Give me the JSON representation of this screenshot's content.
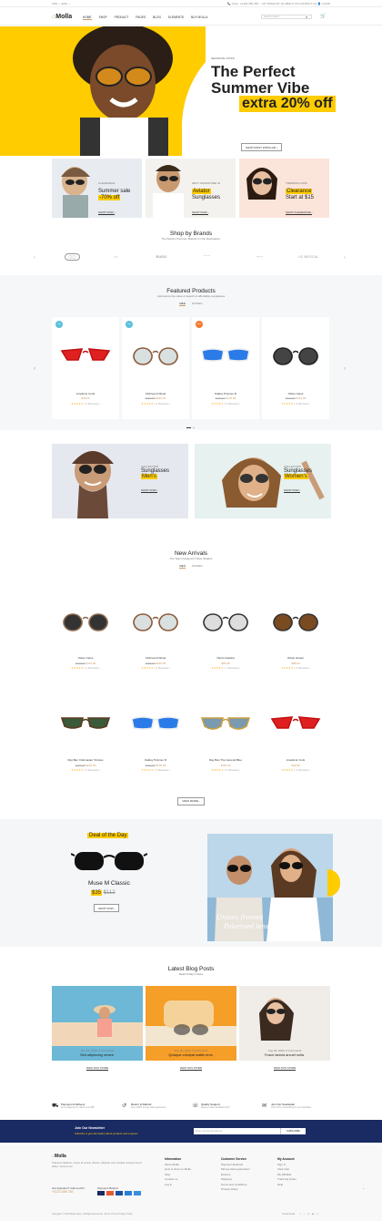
{
  "topbar": {
    "left": "USD ⌄   ENG ⌄",
    "right": "📞 CALL: +0123 456 789   ♡ MY WISHLIST (3)   ABOUT US   CONTACT US   👤 LOGIN"
  },
  "header": {
    "logo": "Molla",
    "nav": [
      "HOME",
      "SHOP",
      "PRODUCT",
      "PAGES",
      "BLOG",
      "ELEMENTS",
      "BUY MOLLA"
    ],
    "search_placeholder": "Search product ..."
  },
  "hero": {
    "kicker": "SEASONAL PICKS",
    "title1": "The Perfect",
    "title2": "Summer Vibe",
    "title3": "extra 20% off",
    "cta": "SHOP MOST POPULAR ›"
  },
  "banners": [
    {
      "kicker": "CLEARANCE",
      "line1": "Summer sale",
      "line2": "-70% off",
      "cta": "SHOP NOW ›"
    },
    {
      "kicker": "NEXT ADVENTURE IN",
      "line1": "Aviator",
      "line2": "Sunglasses",
      "cta": "SHOP NOW ›"
    },
    {
      "kicker": "TRENDING NOW",
      "line1": "Clearance",
      "line2": "Start at $15",
      "cta": "SHOP CLEARANCE ›"
    }
  ],
  "brands": {
    "title": "Shop by Brands",
    "subtitle": "The World's Premium Brands In One Destination.",
    "logos": [
      "",
      "",
      "RUGO",
      "",
      "",
      "LE BROCAL"
    ]
  },
  "featured": {
    "title": "Featured Products",
    "subtitle": "Aprimentre the video of search of affordable sunglasses",
    "tabs": [
      "MEN",
      "WOMEN"
    ],
    "products": [
      {
        "badge": "Top",
        "name": "Amelia E. Funk",
        "price": "$49.99",
        "old": "",
        "reviews": "( 4 Reviews )"
      },
      {
        "badge": "Top",
        "name": "Clubround Wood",
        "price": "$224.00",
        "old": "$250.00",
        "reviews": "( 2 Reviews )"
      },
      {
        "badge": "New",
        "name": "Oakley Polymer R",
        "price": "$178.00",
        "old": "$190.00",
        "reviews": "( 5 Reviews )"
      },
      {
        "badge": "",
        "name": "Ottoto Caine",
        "price": "$114.00",
        "old": "$140.00",
        "reviews": "( 4 Reviews )"
      }
    ]
  },
  "collections": [
    {
      "kicker": "COLLECTION",
      "line1": "Sunglasses",
      "line2": "Men's",
      "cta": "SHOP NOW ›"
    },
    {
      "kicker": "COLLECTION",
      "line1": "Sunglasses",
      "line2": "Women's",
      "cta": "SHOP NOW ›"
    }
  ],
  "arrivals": {
    "title": "New Arrivals",
    "subtitle": "Our Team Designed These Shades",
    "tabs": [
      "MEN",
      "WOMEN"
    ],
    "products": [
      {
        "badge": "",
        "name": "Ottoto Caine",
        "price": "$114.00",
        "old": "$130.00",
        "reviews": "( 4 Reviews )"
      },
      {
        "badge": "",
        "name": "Clubround Wood",
        "price": "$224.00",
        "old": "$280.00",
        "reviews": "( 2 Reviews )"
      },
      {
        "badge": "",
        "name": "Ottoto Caledra",
        "price": "$84.00",
        "old": "",
        "reviews": "( 1 Reviews )"
      },
      {
        "badge": "",
        "name": "Ottoto Harper",
        "price": "$88.00",
        "old": "",
        "reviews": "( 3 Reviews )"
      },
      {
        "badge": "",
        "name": "Ray Ban Clubmaster Tortoise",
        "price": "$210.00",
        "old": "$230.00",
        "reviews": "( 4 Reviews )"
      },
      {
        "badge": "",
        "name": "Oakley Polymer R",
        "price": "$178.00",
        "old": "$190.00",
        "reviews": "( 4 Reviews )"
      },
      {
        "badge": "",
        "name": "Ray Ban The General Blue",
        "price": "$160.00",
        "old": "",
        "reviews": "( 5 Reviews )"
      },
      {
        "badge": "",
        "name": "Amelia E. Funk",
        "price": "$49.99",
        "old": "",
        "reviews": "( 4 Reviews )"
      }
    ],
    "more": "VIEW MORE ›"
  },
  "deal": {
    "label": "Deal of the Day",
    "name": "Muse M Classic",
    "price": "$35",
    "old": "$112",
    "cta": "SHOP NOW ›",
    "script1": "Unisex frames",
    "script2": "Polarised lenses"
  },
  "blog": {
    "title": "Latest Blog Posts",
    "subtitle": "Read Today's News",
    "posts": [
      {
        "meta": "Nov 22, 2020, 0 Comments",
        "title": "Sed adipiscing ornare.",
        "cta": "VIEW THIS STORE"
      },
      {
        "meta": "Nov 20, 2020, 0 Comments",
        "title": "Quisque volutpat mattis eros.",
        "cta": "VIEW THIS STORE"
      },
      {
        "meta": "Aug 28, 2020, 0 Comments",
        "title": "Fusce lacinia arcuet nulla.",
        "cta": "VIEW THIS STORE"
      }
    ]
  },
  "features": [
    {
      "title": "Payment & Delivery",
      "sub": "Free shipping for orders over $50"
    },
    {
      "title": "Return & Refund",
      "sub": "Free 100% money back guarantee"
    },
    {
      "title": "Quality Support",
      "sub": "Always online feedback 24/7"
    },
    {
      "title": "Join Our Newsletter",
      "sub": "10% off by subscribing to our newsletter"
    }
  ],
  "newsletter": {
    "title": "Join Our Newsletter",
    "sub": "Subcribe to get information about products and coupons",
    "placeholder": "Enter your Email Address",
    "cta": "SUBSCRIBE"
  },
  "footer": {
    "logo": "Molla",
    "about": "Praesent dapibus, neque id cursus ultrices. Aliquam erat volutpat. Aenean lorem tellus, rhoncus vel.",
    "question": "Got Question? Call us 24/7",
    "phone": "+0123 456 789",
    "payment": "Payment Method",
    "cols": [
      {
        "title": "Information",
        "items": [
          "About Molla",
          "How to shop on Molla",
          "FAQ",
          "Contact us",
          "Log in"
        ]
      },
      {
        "title": "Customer Service",
        "items": [
          "Payment Methods",
          "Money-back guarantee!",
          "Returns",
          "Shipping",
          "Terms and conditions",
          "Privacy Policy"
        ]
      },
      {
        "title": "My Account",
        "items": [
          "Sign In",
          "View Cart",
          "My Wishlist",
          "Track My Order",
          "Help"
        ]
      }
    ],
    "copyright": "Copyright © 2019 Molla Store. All Rights Reserved.   Terms Of Use   Privacy Policy",
    "social": "Social Media"
  },
  "colors": {
    "accent": "#c96",
    "yellow": "#ffcc00",
    "navy": "#1a2a63"
  }
}
